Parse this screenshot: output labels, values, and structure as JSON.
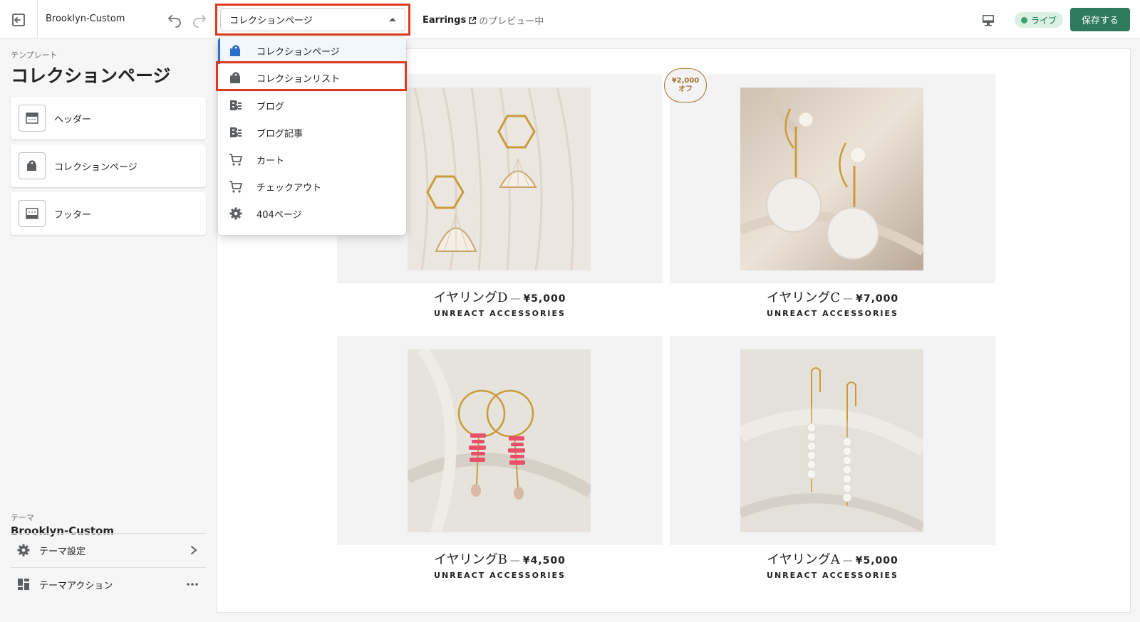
{
  "topbar": {
    "theme_name": "Brooklyn-Custom",
    "page_select_value": "コレクションページ",
    "preview_product": "Earrings",
    "preview_suffix": "のプレビュー中",
    "live_badge": "ライブ",
    "save_label": "保存する"
  },
  "sidebar": {
    "caption": "テンプレート",
    "title": "コレクションページ",
    "sections": [
      {
        "label": "ヘッダー",
        "icon": "header-section-icon"
      },
      {
        "label": "コレクションページ",
        "icon": "collection-tag-icon"
      },
      {
        "label": "フッター",
        "icon": "footer-section-icon"
      }
    ],
    "theme_caption": "テーマ",
    "theme_name": "Brooklyn-Custom",
    "theme_settings": "テーマ設定",
    "theme_actions": "テーマアクション"
  },
  "dropdown": {
    "items": [
      {
        "label": "コレクションページ",
        "icon": "collection-tag-icon"
      },
      {
        "label": "コレクションリスト",
        "icon": "collection-tag-icon"
      },
      {
        "label": "ブログ",
        "icon": "blog-icon"
      },
      {
        "label": "ブログ記事",
        "icon": "blog-post-icon"
      },
      {
        "label": "カート",
        "icon": "cart-icon"
      },
      {
        "label": "チェックアウト",
        "icon": "checkout-cart-icon"
      },
      {
        "label": "404ページ",
        "icon": "gear-icon"
      }
    ]
  },
  "products": [
    {
      "name": "イヤリングD",
      "sep": "—",
      "price": "¥5,000",
      "vendor": "UNREACT ACCESSORIES"
    },
    {
      "name": "イヤリングC",
      "sep": "—",
      "price": "¥7,000",
      "vendor": "UNREACT ACCESSORIES",
      "badge_line1": "¥2,000",
      "badge_line2": "オフ"
    },
    {
      "name": "イヤリングB",
      "sep": "—",
      "price": "¥4,500",
      "vendor": "UNREACT ACCESSORIES"
    },
    {
      "name": "イヤリングA",
      "sep": "—",
      "price": "¥5,000",
      "vendor": "UNREACT ACCESSORIES"
    }
  ],
  "colors": {
    "save_button": "#2d7a5d",
    "live_badge_bg": "#d9f0e3",
    "highlight": "#e03a1e",
    "selected_accent": "#2c6ecb"
  }
}
